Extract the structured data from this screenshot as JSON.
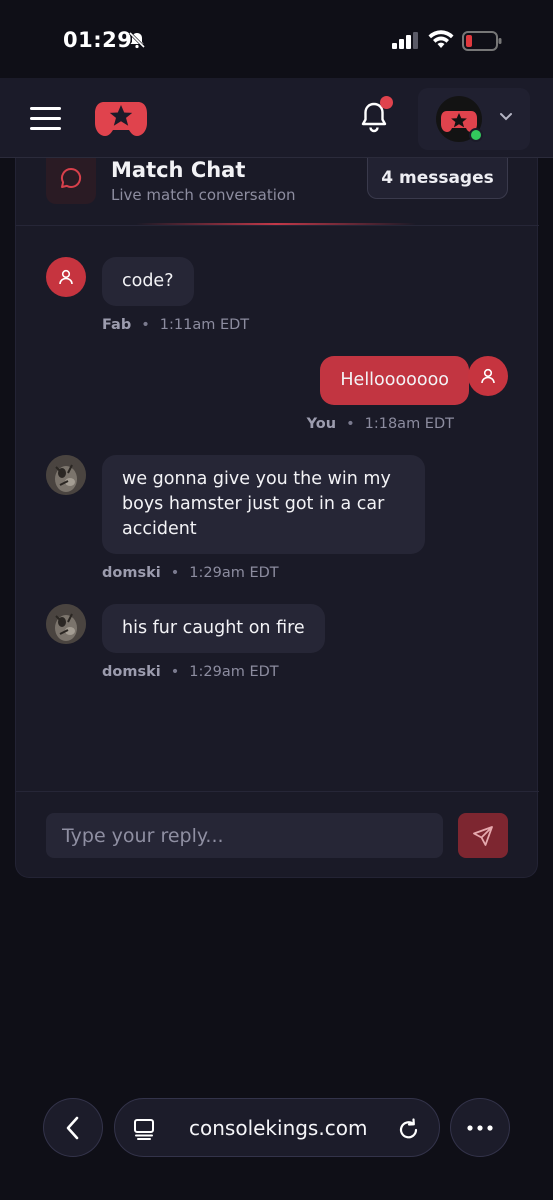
{
  "status_bar": {
    "time": "01:29",
    "icons": [
      "bell-slash-icon",
      "signal-icon",
      "wifi-icon",
      "battery-low-icon"
    ]
  },
  "nav": {
    "icons": [
      "hamburger-icon",
      "logo",
      "bell-icon",
      "avatar",
      "chevron-down-icon"
    ],
    "accent": "#e0434d"
  },
  "chat": {
    "title": "Match Chat",
    "subtitle": "Live match conversation",
    "count": "4 messages",
    "messages": [
      {
        "sender": "Fab",
        "text": "code?",
        "time": "1:11am EDT",
        "mine": false
      },
      {
        "sender": "You",
        "text": "Hellooooooo",
        "time": "1:18am EDT",
        "mine": true
      },
      {
        "sender": "domski",
        "text": "we gonna give you the win my boys hamster just got in a car accident",
        "time": "1:29am EDT",
        "mine": false
      },
      {
        "sender": "domski",
        "text": "his fur caught on fire",
        "time": "1:29am EDT",
        "mine": false
      }
    ],
    "separator": "•",
    "reply_placeholder": "Type your reply..."
  },
  "browser": {
    "url": "consolekings.com"
  },
  "colors": {
    "background": "#0f0f17",
    "card": "#1a1a27",
    "bubble": "#262636",
    "my_bubble": "#c23541",
    "brand": "#e0434d"
  }
}
